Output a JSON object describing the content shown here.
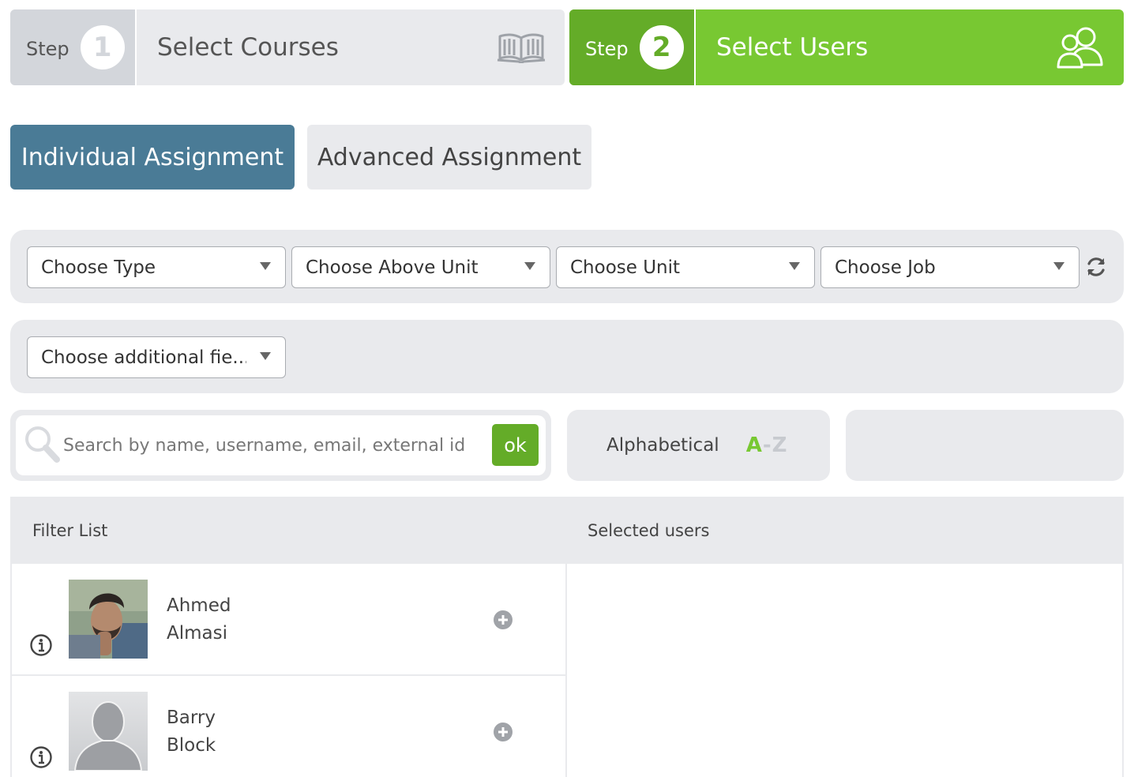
{
  "steps": [
    {
      "word": "Step",
      "number": "1",
      "title": "Select Courses",
      "icon": "open-book-icon",
      "state": "inactive"
    },
    {
      "word": "Step",
      "number": "2",
      "title": "Select Users",
      "icon": "users-icon",
      "state": "active"
    }
  ],
  "tabs": {
    "individual": "Individual Assignment",
    "advanced": "Advanced Assignment"
  },
  "filters": {
    "type": "Choose Type",
    "above_unit": "Choose Above Unit",
    "unit": "Choose Unit",
    "job": "Choose Job",
    "additional": "Choose additional fie..."
  },
  "search": {
    "placeholder": "Search by name, username, email, external id",
    "ok_label": "ok"
  },
  "sort": {
    "label": "Alphabetical",
    "az_a": "A",
    "az_dash": "-",
    "az_z": "Z"
  },
  "lists": {
    "filter_header": "Filter List",
    "selected_header": "Selected users"
  },
  "users": [
    {
      "first": "Ahmed",
      "last": "Almasi",
      "avatar": "photo"
    },
    {
      "first": "Barry",
      "last": "Block",
      "avatar": "placeholder-silhouette"
    }
  ],
  "colors": {
    "active_green": "#78c832",
    "dark_green": "#64ac28",
    "tab_blue": "#4a7b96",
    "panel_gray": "#e9eaed"
  }
}
